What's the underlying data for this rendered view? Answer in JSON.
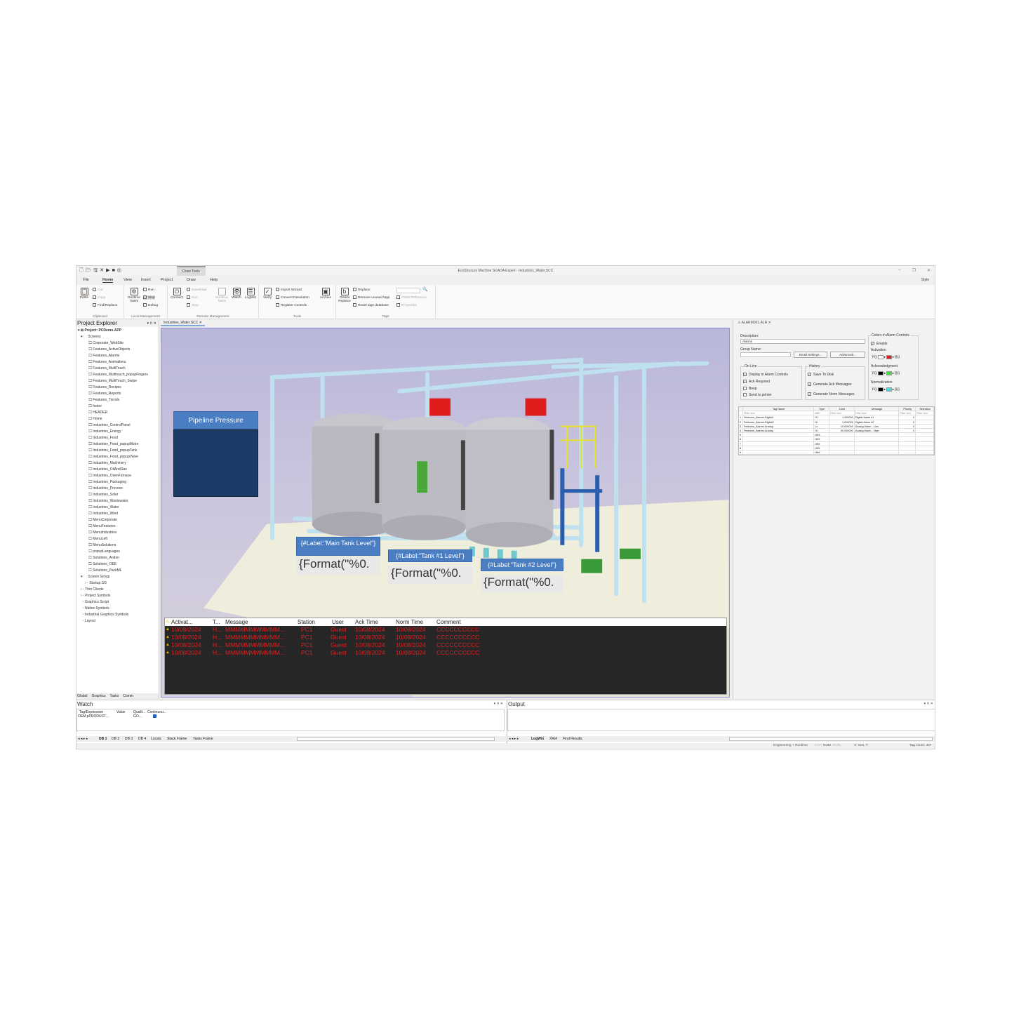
{
  "titlebar": {
    "context_tab": "Draw Tools",
    "title": "EcoStruxure Machine SCADA Expert - Industries_Water.SCC",
    "min": "–",
    "max": "❐",
    "close": "✕"
  },
  "menu": {
    "items": [
      "File",
      "Home",
      "View",
      "Insert",
      "Project",
      "Draw",
      "Help"
    ],
    "style": "Style"
  },
  "ribbon": {
    "clipboard": {
      "label": "Clipboard",
      "paste": "Paste",
      "cut": "Cut",
      "copy": "Copy",
      "find": "Find/Replace"
    },
    "local": {
      "label": "Local Management",
      "runtime_tasks": "Runtime\nTasks",
      "run": "Run",
      "stop": "Stop",
      "debug": "Debug"
    },
    "remote": {
      "label": "Remote Management",
      "connect": "Connect",
      "download": "Download",
      "run": "Run",
      "stop": "Stop",
      "runtime_tasks": "Runtime\nTasks",
      "watch": "Watch",
      "logwin": "LogWin"
    },
    "tools": {
      "label": "Tools",
      "verify": "Verify",
      "import": "Import Wizard",
      "convert": "Convert Resolution",
      "register": "Register Controls",
      "archive": "Archive"
    },
    "tags": {
      "label": "Tags",
      "global_replace": "Global\nReplace",
      "replace": "Replace",
      "remove": "Remove unused tags",
      "reset": "Reset tags database",
      "cross": "Cross Reference",
      "properties": "Properties"
    }
  },
  "explorer": {
    "title": "Project Explorer",
    "project": "Project: PCDemo.APP",
    "screens_label": "Screens",
    "screens": [
      "Corporate_WebSite",
      "Features_ActiveObjects",
      "Features_Alarms",
      "Features_Animations",
      "Features_MultiTouch",
      "Features_Multitouch_popupFingers",
      "Features_MultiTouch_Swipe",
      "Features_Recipes",
      "Features_Reports",
      "Features_Trends",
      "footer",
      "HEADER",
      "Home",
      "Industries_ControlPanel",
      "Industries_Energy",
      "Industries_Food",
      "Industries_Food_popupMotor",
      "Industries_Food_popupTank",
      "Industries_Food_popupValve",
      "Industries_Machinery",
      "Industries_OilAndGas",
      "Industries_OvenFurnace",
      "Industries_Packaging",
      "Industries_Process",
      "Industries_Solar",
      "Industries_Wastewater",
      "Industries_Water",
      "Industries_Wind",
      "MenuCorporate",
      "MenuFeatures",
      "MenuIndustries",
      "MenuLeft",
      "MenuSolutions",
      "popupLanguages",
      "Solutions_Andon",
      "Solutions_OEE",
      "Solutions_PackML"
    ],
    "screen_group": "Screen Group",
    "startup": "Startup.SG",
    "others": [
      "Thin Clients",
      "Project Symbols",
      "Graphics Script",
      "Native Symbols",
      "Industrial Graphics Symbols",
      "Layout"
    ],
    "tabs": [
      "Global",
      "Graphics",
      "Tasks",
      "Comm"
    ]
  },
  "doc": {
    "tab": "Industries_Water.SCC",
    "pipeline_title": "Pipeline Pressure",
    "labels": [
      {
        "text": "{#Label:\"Main Tank Level\"}",
        "fmt": "{Format(\"%0."
      },
      {
        "text": "{#Label:\"Tank #1 Level\"}",
        "fmt": "{Format(\"%0."
      },
      {
        "text": "{#Label:\"Tank #2 Level\"}",
        "fmt": "{Format(\"%0."
      }
    ],
    "alarm_headers": [
      "Activat...",
      "T...",
      "Message",
      "Station",
      "User",
      "Ack Time",
      "Norm Time",
      "Comment"
    ],
    "alarm_rows": [
      [
        "10/08/2024",
        "H...",
        "MMMMMMMMMMM...",
        "PC1",
        "Guest",
        "10/08/2024",
        "10/08/2024",
        "CCCCCCCCCC"
      ],
      [
        "10/08/2024",
        "H...",
        "MMMMMMMMMMM...",
        "PC1",
        "Guest",
        "10/08/2024",
        "10/08/2024",
        "CCCCCCCCCC"
      ],
      [
        "10/08/2024",
        "H...",
        "MMMMMMMMMMM...",
        "PC1",
        "Guest",
        "10/08/2024",
        "10/08/2024",
        "CCCCCCCCCC"
      ],
      [
        "10/08/2024",
        "H...",
        "MMMMMMMMMMM...",
        "PC1",
        "Guest",
        "10/08/2024",
        "10/08/2024",
        "CCCCCCCCCC"
      ]
    ]
  },
  "alarm_panel": {
    "tab": "ALARM001.ALR",
    "description_label": "Description:",
    "description": "Alarms",
    "group_label": "Group Name:",
    "email": "Email Settings...",
    "advanced": "Advanced...",
    "online": "On Line",
    "online_items": [
      "Display in Alarm Controls",
      "Ack Required",
      "Beep",
      "Send to printer"
    ],
    "history": "History",
    "history_items": [
      "Save To Disk",
      "Generate Ack Messages",
      "Generate Norm Messages"
    ],
    "colors": "Colors in Alarm Controls",
    "enable": "Enable",
    "activation": "Activation",
    "acknowledgment": "Acknowledgment",
    "normalization": "Normalization",
    "fg": "FG",
    "bg": "BG",
    "grid_headers": [
      "Tag Name",
      "Type",
      "Limit",
      "Message",
      "Priority",
      "Selection"
    ],
    "filter": "Filter text",
    "grid_rows": [
      [
        "1",
        "Features_Alarms.Digital1",
        "Hi",
        "1.000000",
        "Digital Alarm #1",
        "0",
        ""
      ],
      [
        "2",
        "Features_Alarms.Digital2",
        "Hi",
        "1.000000",
        "Digital Alarm #2",
        "0",
        ""
      ],
      [
        "3",
        "Features_Alarms.Analog",
        "Lo",
        "10.000000",
        "Analog Alarm - Low",
        "0",
        ""
      ],
      [
        "4",
        "Features_Alarms.Analog",
        "Hi",
        "90.000000",
        "Analog Alarm - High",
        "0",
        ""
      ],
      [
        "5",
        "",
        "HiHi",
        "",
        "",
        "",
        ""
      ],
      [
        "6",
        "",
        "HiHi",
        "",
        "",
        "",
        ""
      ],
      [
        "7",
        "",
        "HiHi",
        "",
        "",
        "",
        ""
      ],
      [
        "8",
        "",
        "HiHi",
        "",
        "",
        "",
        ""
      ],
      [
        "9",
        "",
        "HiHi",
        "",
        "",
        "",
        ""
      ]
    ]
  },
  "watch": {
    "title": "Watch",
    "cols": [
      "Tag/Expression",
      "Value",
      "Qualit...",
      "Continuou..."
    ],
    "row": [
      "OEM.pPRODUCT...",
      "",
      "GO...",
      ""
    ],
    "tabs": [
      "DB 1",
      "DB 2",
      "DB 3",
      "DB 4",
      "Locals",
      "Stack Frame",
      "Tasks Frame"
    ]
  },
  "output": {
    "title": "Output",
    "tabs": [
      "LogWin",
      "XRef",
      "Find Results"
    ]
  },
  "status": {
    "mode": "Engineering + Runtime",
    "caps": "CAP",
    "num": "NUM",
    "scrl": "SCRL",
    "coords": "X: 618, Y:",
    "tag_count": "Tag count: 407"
  },
  "colors": {
    "accent": "#4a7dc2",
    "alarm_text": "#e02020",
    "alarm_bg": "#262626",
    "dark_box": "#1b3b66"
  }
}
